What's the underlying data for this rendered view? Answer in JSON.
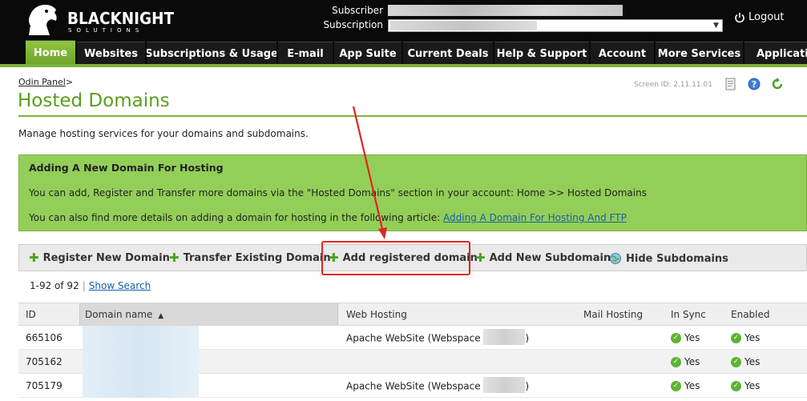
{
  "brand": {
    "name": "BLACKNIGHT",
    "tagline": "SOLUTIONS"
  },
  "header": {
    "subscriber_label": "Subscriber",
    "subscription_label": "Subscription",
    "logout_label": "Logout"
  },
  "nav": {
    "tabs": [
      {
        "label": "Home",
        "active": true
      },
      {
        "label": "Websites"
      },
      {
        "label": "Subscriptions & Usage"
      },
      {
        "label": "E-mail"
      },
      {
        "label": "App Suite"
      },
      {
        "label": "Current Deals"
      },
      {
        "label": "Help & Support"
      },
      {
        "label": "Account"
      },
      {
        "label": "More Services"
      },
      {
        "label": "Applications"
      }
    ]
  },
  "breadcrumb": {
    "root": "Odin Panel",
    "sep": ">"
  },
  "page": {
    "title": "Hosted Domains",
    "screen_id_label": "Screen ID:",
    "screen_id": "2.11.11.01",
    "description": "Manage hosting services for your domains and subdomains."
  },
  "notice": {
    "heading": "Adding A New Domain For Hosting",
    "line1": "You can add, Register and Transfer more domains via the \"Hosted Domains\" section in your account: Home >> Hosted Domains",
    "line2": "You can also find more details on adding a domain for hosting in the following article:",
    "link": "Adding A Domain For Hosting And FTP"
  },
  "toolbar": {
    "register": "Register New Domain",
    "transfer": "Transfer Existing Domain",
    "add_registered": "Add registered domain",
    "add_subdomain": "Add New Subdomain",
    "hide_subdomains": "Hide Subdomains"
  },
  "list": {
    "range": "1-92 of 92",
    "show_search": "Show Search"
  },
  "table": {
    "columns": {
      "id": "ID",
      "domain": "Domain name",
      "web": "Web Hosting",
      "mail": "Mail Hosting",
      "sync": "In Sync",
      "enabled": "Enabled"
    },
    "rows": [
      {
        "id": "665106",
        "web_prefix": "Apache WebSite (Webspace",
        "web_suffix": ")",
        "sync": "Yes",
        "enabled": "Yes"
      },
      {
        "id": "705162",
        "web_prefix": "",
        "web_suffix": "",
        "sync": "Yes",
        "enabled": "Yes"
      },
      {
        "id": "705179",
        "web_prefix": "Apache WebSite (Webspace",
        "web_suffix": ")",
        "sync": "Yes",
        "enabled": "Yes"
      }
    ]
  },
  "colors": {
    "accent": "#7fb336",
    "title": "#5a9e1c",
    "notice_bg": "#93cf58",
    "annotation": "#e02424"
  }
}
